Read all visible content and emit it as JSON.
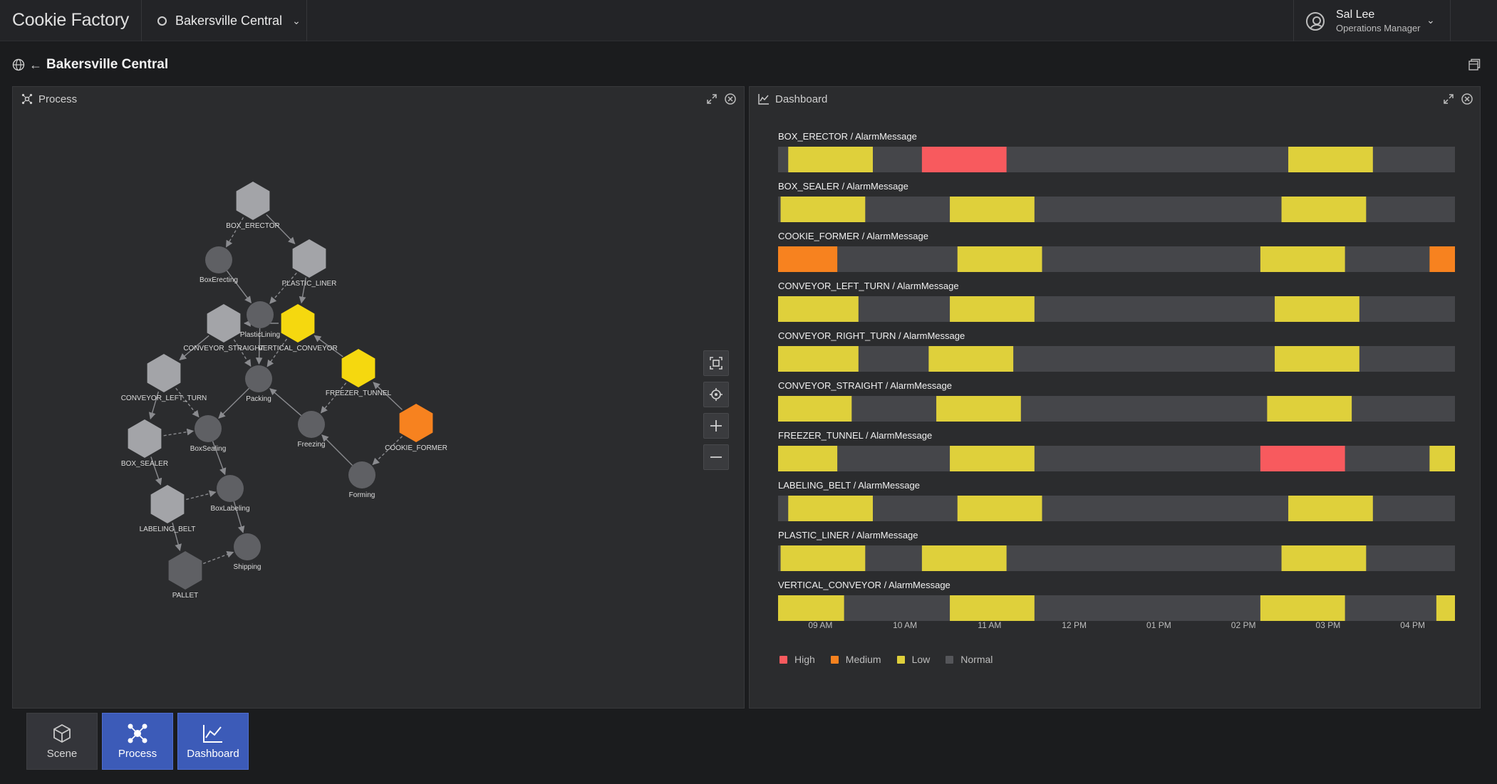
{
  "app": {
    "brand": "Cookie Factory"
  },
  "site_selector": {
    "value": "Bakersville Central"
  },
  "user": {
    "name": "Sal Lee",
    "role": "Operations Manager"
  },
  "breadcrumb": {
    "title": "Bakersville Central"
  },
  "process_panel": {
    "title": "Process",
    "nodes": [
      {
        "id": "BOX_ERECTOR",
        "shape": "hex",
        "color": "#a3a4a8"
      },
      {
        "id": "BoxErecting",
        "shape": "circle",
        "color": "#5f6064"
      },
      {
        "id": "PLASTIC_LINER",
        "shape": "hex",
        "color": "#a3a4a8"
      },
      {
        "id": "PlasticLining",
        "shape": "circle",
        "color": "#5f6064"
      },
      {
        "id": "CONVEYOR_STRAIGHT",
        "shape": "hex",
        "color": "#a3a4a8"
      },
      {
        "id": "VERTICAL_CONVEYOR",
        "shape": "hex",
        "color": "#f5d80f"
      },
      {
        "id": "CONVEYOR_LEFT_TURN",
        "shape": "hex",
        "color": "#a3a4a8"
      },
      {
        "id": "Packing",
        "shape": "circle",
        "color": "#5f6064"
      },
      {
        "id": "FREEZER_TUNNEL",
        "shape": "hex",
        "color": "#f5d80f"
      },
      {
        "id": "BOX_SEALER",
        "shape": "hex",
        "color": "#a3a4a8"
      },
      {
        "id": "BoxSealing",
        "shape": "circle",
        "color": "#5f6064"
      },
      {
        "id": "Freezing",
        "shape": "circle",
        "color": "#5f6064"
      },
      {
        "id": "COOKIE_FORMER",
        "shape": "hex",
        "color": "#f7821f"
      },
      {
        "id": "Forming",
        "shape": "circle",
        "color": "#5f6064"
      },
      {
        "id": "LABELING_BELT",
        "shape": "hex",
        "color": "#a3a4a8"
      },
      {
        "id": "BoxLabeling",
        "shape": "circle",
        "color": "#5f6064"
      },
      {
        "id": "Shipping",
        "shape": "circle",
        "color": "#5f6064"
      },
      {
        "id": "PALLET",
        "shape": "hex",
        "color": "#5f6064"
      }
    ],
    "edges": [
      {
        "from": "BOX_ERECTOR",
        "to": "BoxErecting",
        "dashed": true
      },
      {
        "from": "BOX_ERECTOR",
        "to": "PLASTIC_LINER",
        "dashed": false
      },
      {
        "from": "BoxErecting",
        "to": "PlasticLining",
        "dashed": false
      },
      {
        "from": "PLASTIC_LINER",
        "to": "PlasticLining",
        "dashed": true
      },
      {
        "from": "PLASTIC_LINER",
        "to": "VERTICAL_CONVEYOR",
        "dashed": false
      },
      {
        "from": "VERTICAL_CONVEYOR",
        "to": "CONVEYOR_STRAIGHT",
        "dashed": false
      },
      {
        "from": "PlasticLining",
        "to": "Packing",
        "dashed": false
      },
      {
        "from": "CONVEYOR_STRAIGHT",
        "to": "Packing",
        "dashed": true
      },
      {
        "from": "VERTICAL_CONVEYOR",
        "to": "Packing",
        "dashed": true
      },
      {
        "from": "CONVEYOR_STRAIGHT",
        "to": "CONVEYOR_LEFT_TURN",
        "dashed": false
      },
      {
        "from": "FREEZER_TUNNEL",
        "to": "VERTICAL_CONVEYOR",
        "dashed": false
      },
      {
        "from": "CONVEYOR_LEFT_TURN",
        "to": "BOX_SEALER",
        "dashed": false
      },
      {
        "from": "CONVEYOR_LEFT_TURN",
        "to": "BoxSealing",
        "dashed": true
      },
      {
        "from": "Packing",
        "to": "BoxSealing",
        "dashed": false
      },
      {
        "from": "Freezing",
        "to": "Packing",
        "dashed": false
      },
      {
        "from": "FREEZER_TUNNEL",
        "to": "Freezing",
        "dashed": true
      },
      {
        "from": "COOKIE_FORMER",
        "to": "FREEZER_TUNNEL",
        "dashed": false
      },
      {
        "from": "BOX_SEALER",
        "to": "BoxSealing",
        "dashed": true
      },
      {
        "from": "BoxSealing",
        "to": "BoxLabeling",
        "dashed": false
      },
      {
        "from": "Forming",
        "to": "Freezing",
        "dashed": false
      },
      {
        "from": "COOKIE_FORMER",
        "to": "Forming",
        "dashed": true
      },
      {
        "from": "BOX_SEALER",
        "to": "LABELING_BELT",
        "dashed": false
      },
      {
        "from": "LABELING_BELT",
        "to": "BoxLabeling",
        "dashed": true
      },
      {
        "from": "BoxLabeling",
        "to": "Shipping",
        "dashed": false
      },
      {
        "from": "LABELING_BELT",
        "to": "PALLET",
        "dashed": false
      },
      {
        "from": "PALLET",
        "to": "Shipping",
        "dashed": true
      }
    ]
  },
  "dashboard_panel": {
    "title": "Dashboard",
    "chart_data": {
      "type": "timeline",
      "x_ticks": [
        "09 AM",
        "10 AM",
        "11 AM",
        "12 PM",
        "01 PM",
        "02 PM",
        "03 PM",
        "04 PM"
      ],
      "x_range_hours": [
        8.5,
        16.5
      ],
      "level_colors": {
        "High": "#f85a5e",
        "Medium": "#f7821f",
        "Low": "#dfd03b",
        "Normal": "#45464a"
      },
      "legend": [
        "High",
        "Medium",
        "Low",
        "Normal"
      ],
      "rows": [
        {
          "label": "BOX_ERECTOR / AlarmMessage",
          "segments": [
            [
              8.62,
              9.62,
              "Low"
            ],
            [
              10.2,
              11.2,
              "High"
            ],
            [
              14.53,
              15.53,
              "Low"
            ]
          ]
        },
        {
          "label": "BOX_SEALER / AlarmMessage",
          "segments": [
            [
              8.53,
              9.53,
              "Low"
            ],
            [
              10.53,
              11.53,
              "Low"
            ],
            [
              14.45,
              15.45,
              "Low"
            ]
          ]
        },
        {
          "label": "COOKIE_FORMER / AlarmMessage",
          "segments": [
            [
              8.5,
              9.2,
              "Medium"
            ],
            [
              10.62,
              11.62,
              "Low"
            ],
            [
              14.2,
              15.2,
              "Low"
            ],
            [
              16.2,
              16.5,
              "Medium"
            ]
          ]
        },
        {
          "label": "CONVEYOR_LEFT_TURN / AlarmMessage",
          "segments": [
            [
              8.5,
              9.45,
              "Low"
            ],
            [
              10.53,
              11.53,
              "Low"
            ],
            [
              14.37,
              15.37,
              "Low"
            ]
          ]
        },
        {
          "label": "CONVEYOR_RIGHT_TURN / AlarmMessage",
          "segments": [
            [
              8.5,
              9.45,
              "Low"
            ],
            [
              10.28,
              11.28,
              "Low"
            ],
            [
              14.37,
              15.37,
              "Low"
            ]
          ]
        },
        {
          "label": "CONVEYOR_STRAIGHT / AlarmMessage",
          "segments": [
            [
              8.5,
              9.37,
              "Low"
            ],
            [
              10.37,
              11.37,
              "Low"
            ],
            [
              14.28,
              15.28,
              "Low"
            ]
          ]
        },
        {
          "label": "FREEZER_TUNNEL / AlarmMessage",
          "segments": [
            [
              8.5,
              9.2,
              "Low"
            ],
            [
              10.53,
              11.53,
              "Low"
            ],
            [
              14.2,
              15.2,
              "High"
            ],
            [
              16.2,
              16.5,
              "Low"
            ]
          ]
        },
        {
          "label": "LABELING_BELT / AlarmMessage",
          "segments": [
            [
              8.62,
              9.62,
              "Low"
            ],
            [
              10.62,
              11.62,
              "Low"
            ],
            [
              14.53,
              15.53,
              "Low"
            ]
          ]
        },
        {
          "label": "PLASTIC_LINER / AlarmMessage",
          "segments": [
            [
              8.53,
              9.53,
              "Low"
            ],
            [
              10.2,
              11.2,
              "Low"
            ],
            [
              14.45,
              15.45,
              "Low"
            ]
          ]
        },
        {
          "label": "VERTICAL_CONVEYOR / AlarmMessage",
          "segments": [
            [
              8.5,
              9.28,
              "Low"
            ],
            [
              10.53,
              11.53,
              "Low"
            ],
            [
              14.2,
              15.2,
              "Low"
            ],
            [
              16.28,
              16.5,
              "Low"
            ]
          ]
        }
      ]
    }
  },
  "bottom_tabs": [
    {
      "label": "Scene",
      "active": false
    },
    {
      "label": "Process",
      "active": true
    },
    {
      "label": "Dashboard",
      "active": true
    }
  ]
}
